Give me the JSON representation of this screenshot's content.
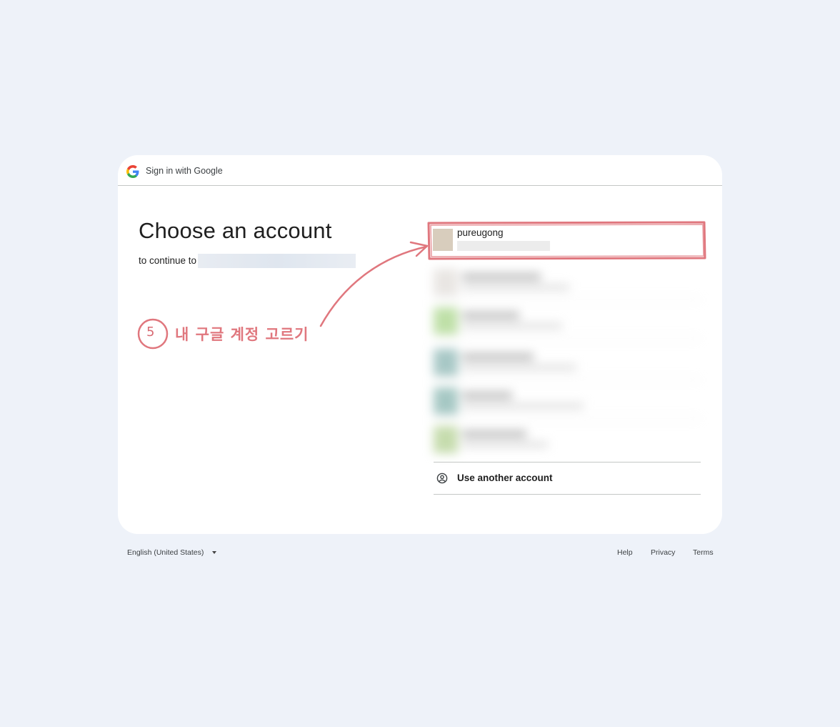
{
  "header": {
    "title": "Sign in with Google",
    "logo_icon": "google-g-icon"
  },
  "main": {
    "heading": "Choose an account",
    "subtitle_prefix": "to continue to"
  },
  "accounts": {
    "selected": {
      "name": "pureugong"
    },
    "use_another_label": "Use another account",
    "use_another_icon": "person-circle-icon"
  },
  "annotation": {
    "step_number": "5",
    "text": "내 구글 계정 고르기",
    "color": "#e0777e"
  },
  "footer": {
    "language": "English (United States)",
    "help": "Help",
    "privacy": "Privacy",
    "terms": "Terms"
  }
}
